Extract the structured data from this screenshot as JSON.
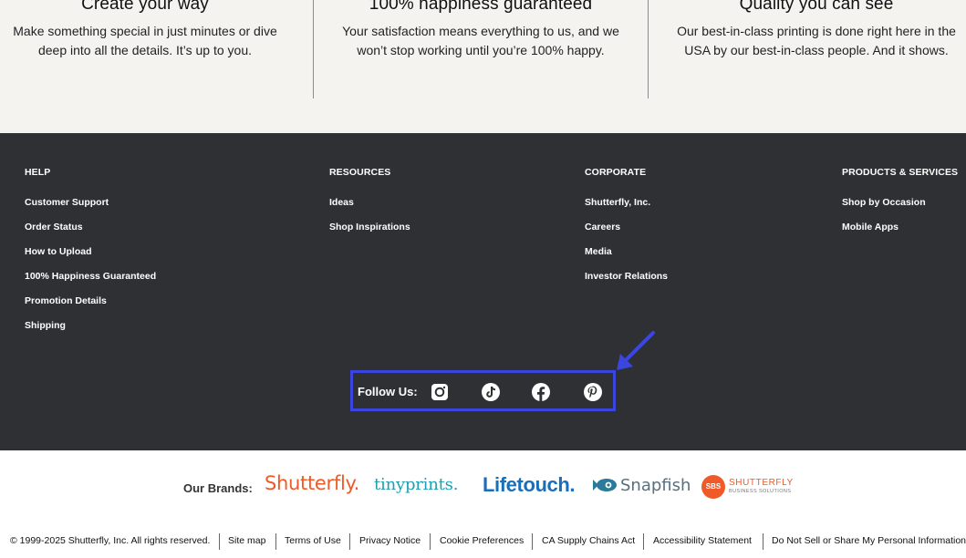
{
  "value_props": [
    {
      "title": "Create your way",
      "body_line1": "Make something special in just minutes or dive",
      "body_line2": "deep into all the details. It’s up to you."
    },
    {
      "title": "100% happiness guaranteed",
      "body_line1": "Your satisfaction means everything to us, and we",
      "body_line2": "won’t stop working until you’re 100% happy."
    },
    {
      "title": "Quality you can see",
      "body_line1": "Our best-in-class printing is done right here in the",
      "body_line2": "USA by our best-in-class people. And it shows."
    }
  ],
  "footer": {
    "help": {
      "heading": "HELP",
      "links": [
        "Customer Support",
        "Order Status",
        "How to Upload",
        "100% Happiness Guaranteed",
        "Promotion Details",
        "Shipping"
      ]
    },
    "resources": {
      "heading": "RESOURCES",
      "links": [
        "Ideas",
        "Shop Inspirations"
      ]
    },
    "corporate": {
      "heading": "CORPORATE",
      "links": [
        "Shutterfly, Inc.",
        "Careers",
        "Media",
        "Investor Relations"
      ]
    },
    "products": {
      "heading": "PRODUCTS & SERVICES",
      "links": [
        "Shop by Occasion",
        "Mobile Apps"
      ]
    },
    "follow_label": "Follow Us:",
    "social_icons": [
      "instagram-icon",
      "tiktok-icon",
      "facebook-icon",
      "pinterest-icon"
    ]
  },
  "brands": {
    "label": "Our Brands:",
    "shutterfly": "Shutterfly.",
    "tinyprints": "tinyprints.",
    "lifetouch": "Lifetouch.",
    "snapfish": "Snapfish",
    "sbs_mark": "SBS",
    "sbs_name": "SHUTTERFLY",
    "sbs_sub": "BUSINESS SOLUTIONS"
  },
  "legal": {
    "copyright": "© 1999-2025 Shutterfly, Inc. All rights reserved.",
    "links": [
      "Site map",
      "Terms of Use",
      "Privacy Notice",
      "Cookie Preferences",
      "CA Supply Chains Act",
      "Accessibility Statement",
      "Do Not Sell or Share My Personal Information"
    ]
  },
  "colors": {
    "footer_bg": "#2e3034",
    "props_bg": "#f4f3f0",
    "highlight": "#3b46e0",
    "shutterfly_orange": "#f05a28",
    "tinyprints_teal": "#1f9fb0",
    "lifetouch_blue": "#1a6fba"
  }
}
